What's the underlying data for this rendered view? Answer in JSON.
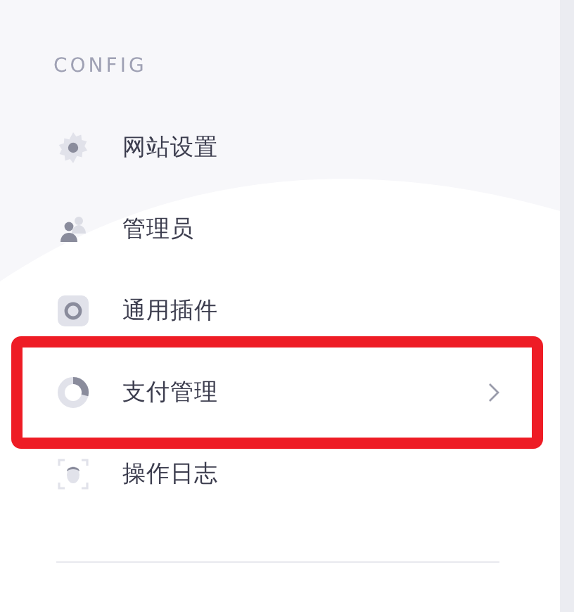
{
  "section_title": "CONFIG",
  "menu": [
    {
      "label": "网站设置",
      "expandable": false,
      "highlighted": false
    },
    {
      "label": "管理员",
      "expandable": false,
      "highlighted": false
    },
    {
      "label": "通用插件",
      "expandable": false,
      "highlighted": false
    },
    {
      "label": "支付管理",
      "expandable": true,
      "highlighted": true
    },
    {
      "label": "操作日志",
      "expandable": false,
      "highlighted": false
    }
  ]
}
